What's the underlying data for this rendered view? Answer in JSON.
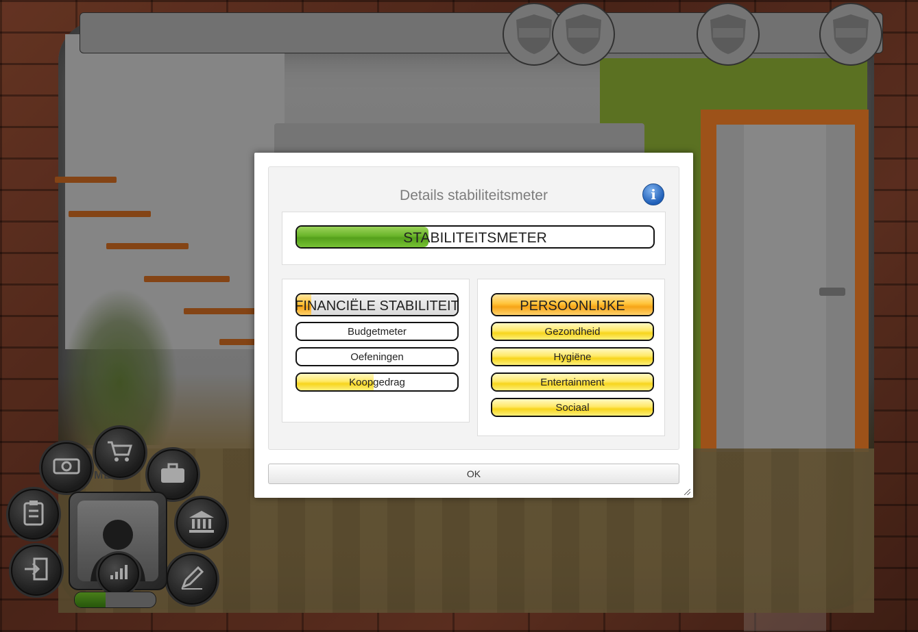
{
  "dialog": {
    "title": "Details stabiliteitsmeter",
    "info_icon_glyph": "i",
    "ok_label": "OK"
  },
  "meter": {
    "label": "STABILITEITSMETER",
    "level": 0.37,
    "color": "#6ab52a"
  },
  "financial": {
    "header": {
      "label": "FINANCIËLE STABILITEIT",
      "level": 0.09
    },
    "items": [
      {
        "label": "Budgetmeter",
        "level": 0
      },
      {
        "label": "Oefeningen",
        "level": 0
      },
      {
        "label": "Koopgedrag",
        "level": 0.48
      }
    ]
  },
  "personal": {
    "header": {
      "label": "PERSOONLIJKE",
      "level": 1.0
    },
    "items": [
      {
        "label": "Gezondheid",
        "level": 1.0
      },
      {
        "label": "Hygiëne",
        "level": 1.0
      },
      {
        "label": "Entertainment",
        "level": 1.0
      },
      {
        "label": "Sociaal",
        "level": 1.0
      }
    ]
  },
  "game_menu": {
    "label": "MENU",
    "stability_level": 0.38,
    "icons": [
      "money-icon",
      "cart-icon",
      "briefcase-icon",
      "clipboard-icon",
      "bank-icon",
      "exit-icon",
      "pen-icon",
      "chart-icon",
      "profile-icon"
    ]
  },
  "colors": {
    "accent_green": "#6ab52a",
    "accent_yellow": "#f7d51d",
    "accent_orange": "#f6a418",
    "info_blue": "#1f5fb8"
  }
}
